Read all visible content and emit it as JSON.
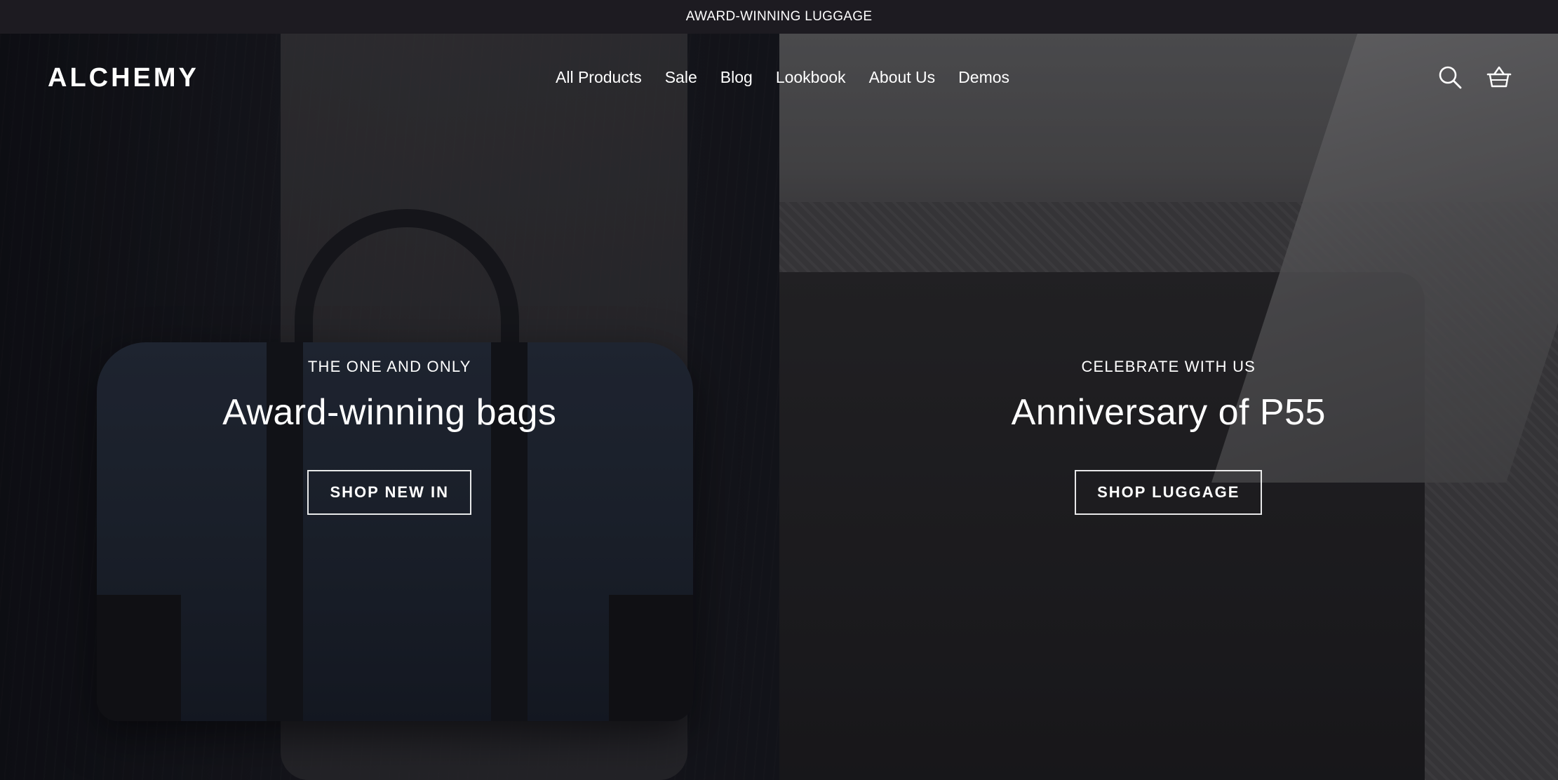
{
  "announcement": {
    "text": "AWARD-WINNING LUGGAGE"
  },
  "header": {
    "logo": "ALCHEMY",
    "nav": [
      {
        "label": "All Products"
      },
      {
        "label": "Sale"
      },
      {
        "label": "Blog"
      },
      {
        "label": "Lookbook"
      },
      {
        "label": "About Us"
      },
      {
        "label": "Demos"
      }
    ],
    "icons": [
      "search-icon",
      "basket-icon"
    ]
  },
  "hero": {
    "left": {
      "eyebrow": "THE ONE AND ONLY",
      "headline": "Award-winning bags",
      "cta": "SHOP NEW IN"
    },
    "right": {
      "eyebrow": "CELEBRATE WITH US",
      "headline": "Anniversary of P55",
      "cta": "SHOP LUGGAGE"
    }
  },
  "colors": {
    "announcement_bg": "#1d1b21",
    "text": "#ffffff"
  }
}
